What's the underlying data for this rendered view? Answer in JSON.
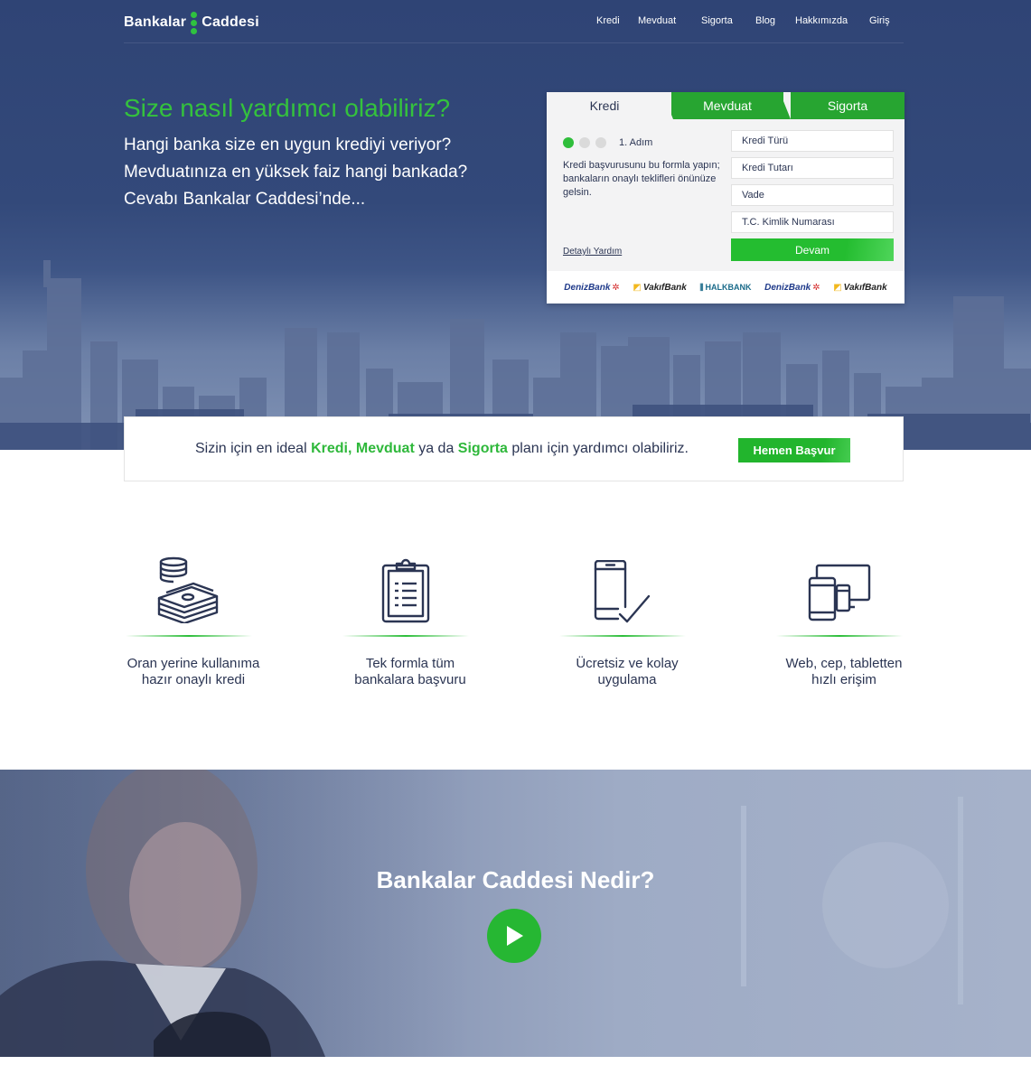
{
  "brand": {
    "name_left": "Bankalar",
    "name_right": "Caddesi"
  },
  "nav": {
    "items": [
      {
        "label": "Kredi"
      },
      {
        "label": "Mevduat"
      },
      {
        "label": "Sigorta"
      },
      {
        "label": "Blog"
      },
      {
        "label": "Hakkımızda"
      },
      {
        "label": "Giriş"
      }
    ]
  },
  "hero": {
    "title": "Size nasıl yardımcı olabiliriz?",
    "lines": [
      "Hangi banka size en uygun krediyi veriyor?",
      "Mevduatınıza en yüksek faiz hangi bankada?",
      "Cevabı Bankalar Caddesi’nde..."
    ]
  },
  "form": {
    "tabs": [
      {
        "label": "Kredi",
        "active": true
      },
      {
        "label": "Mevduat",
        "active": false
      },
      {
        "label": "Sigorta",
        "active": false
      }
    ],
    "step_label": "1. Adım",
    "step_current": 1,
    "step_total": 3,
    "description": "Kredi başvurusunu bu formla yapın; bankaların onaylı teklifleri önünüze gelsin.",
    "help_link": "Detaylı Yardım",
    "fields": [
      {
        "placeholder": "Kredi Türü"
      },
      {
        "placeholder": "Kredi Tutarı"
      },
      {
        "placeholder": "Vade"
      },
      {
        "placeholder": "T.C. Kimlik Numarası"
      }
    ],
    "submit_label": "Devam",
    "banks": [
      "DenizBank",
      "VakıfBank",
      "HALKBANK",
      "DenizBank",
      "VakıfBank"
    ]
  },
  "cta": {
    "text_pre": "Sizin için en ideal ",
    "highlight_1": "Kredi, Mevduat",
    "text_mid": " ya da ",
    "highlight_2": "Sigorta",
    "text_post": " planı için yardımcı olabiliriz.",
    "button_label": "Hemen Başvur"
  },
  "features": [
    {
      "icon": "money-stack-icon",
      "text": "Oran yerine kullanıma hazır onaylı kredi"
    },
    {
      "icon": "clipboard-icon",
      "text": "Tek formla tüm bankalara başvuru"
    },
    {
      "icon": "phone-check-icon",
      "text": "Ücretsiz ve kolay uygulama"
    },
    {
      "icon": "devices-icon",
      "text": "Web, cep, tabletten hızlı erişim"
    }
  ],
  "video": {
    "title": "Bankalar Caddesi Nedir?"
  },
  "colors": {
    "accent_green": "#2fbe3b",
    "navy": "#2f4475",
    "text_dark": "#2b3553"
  }
}
